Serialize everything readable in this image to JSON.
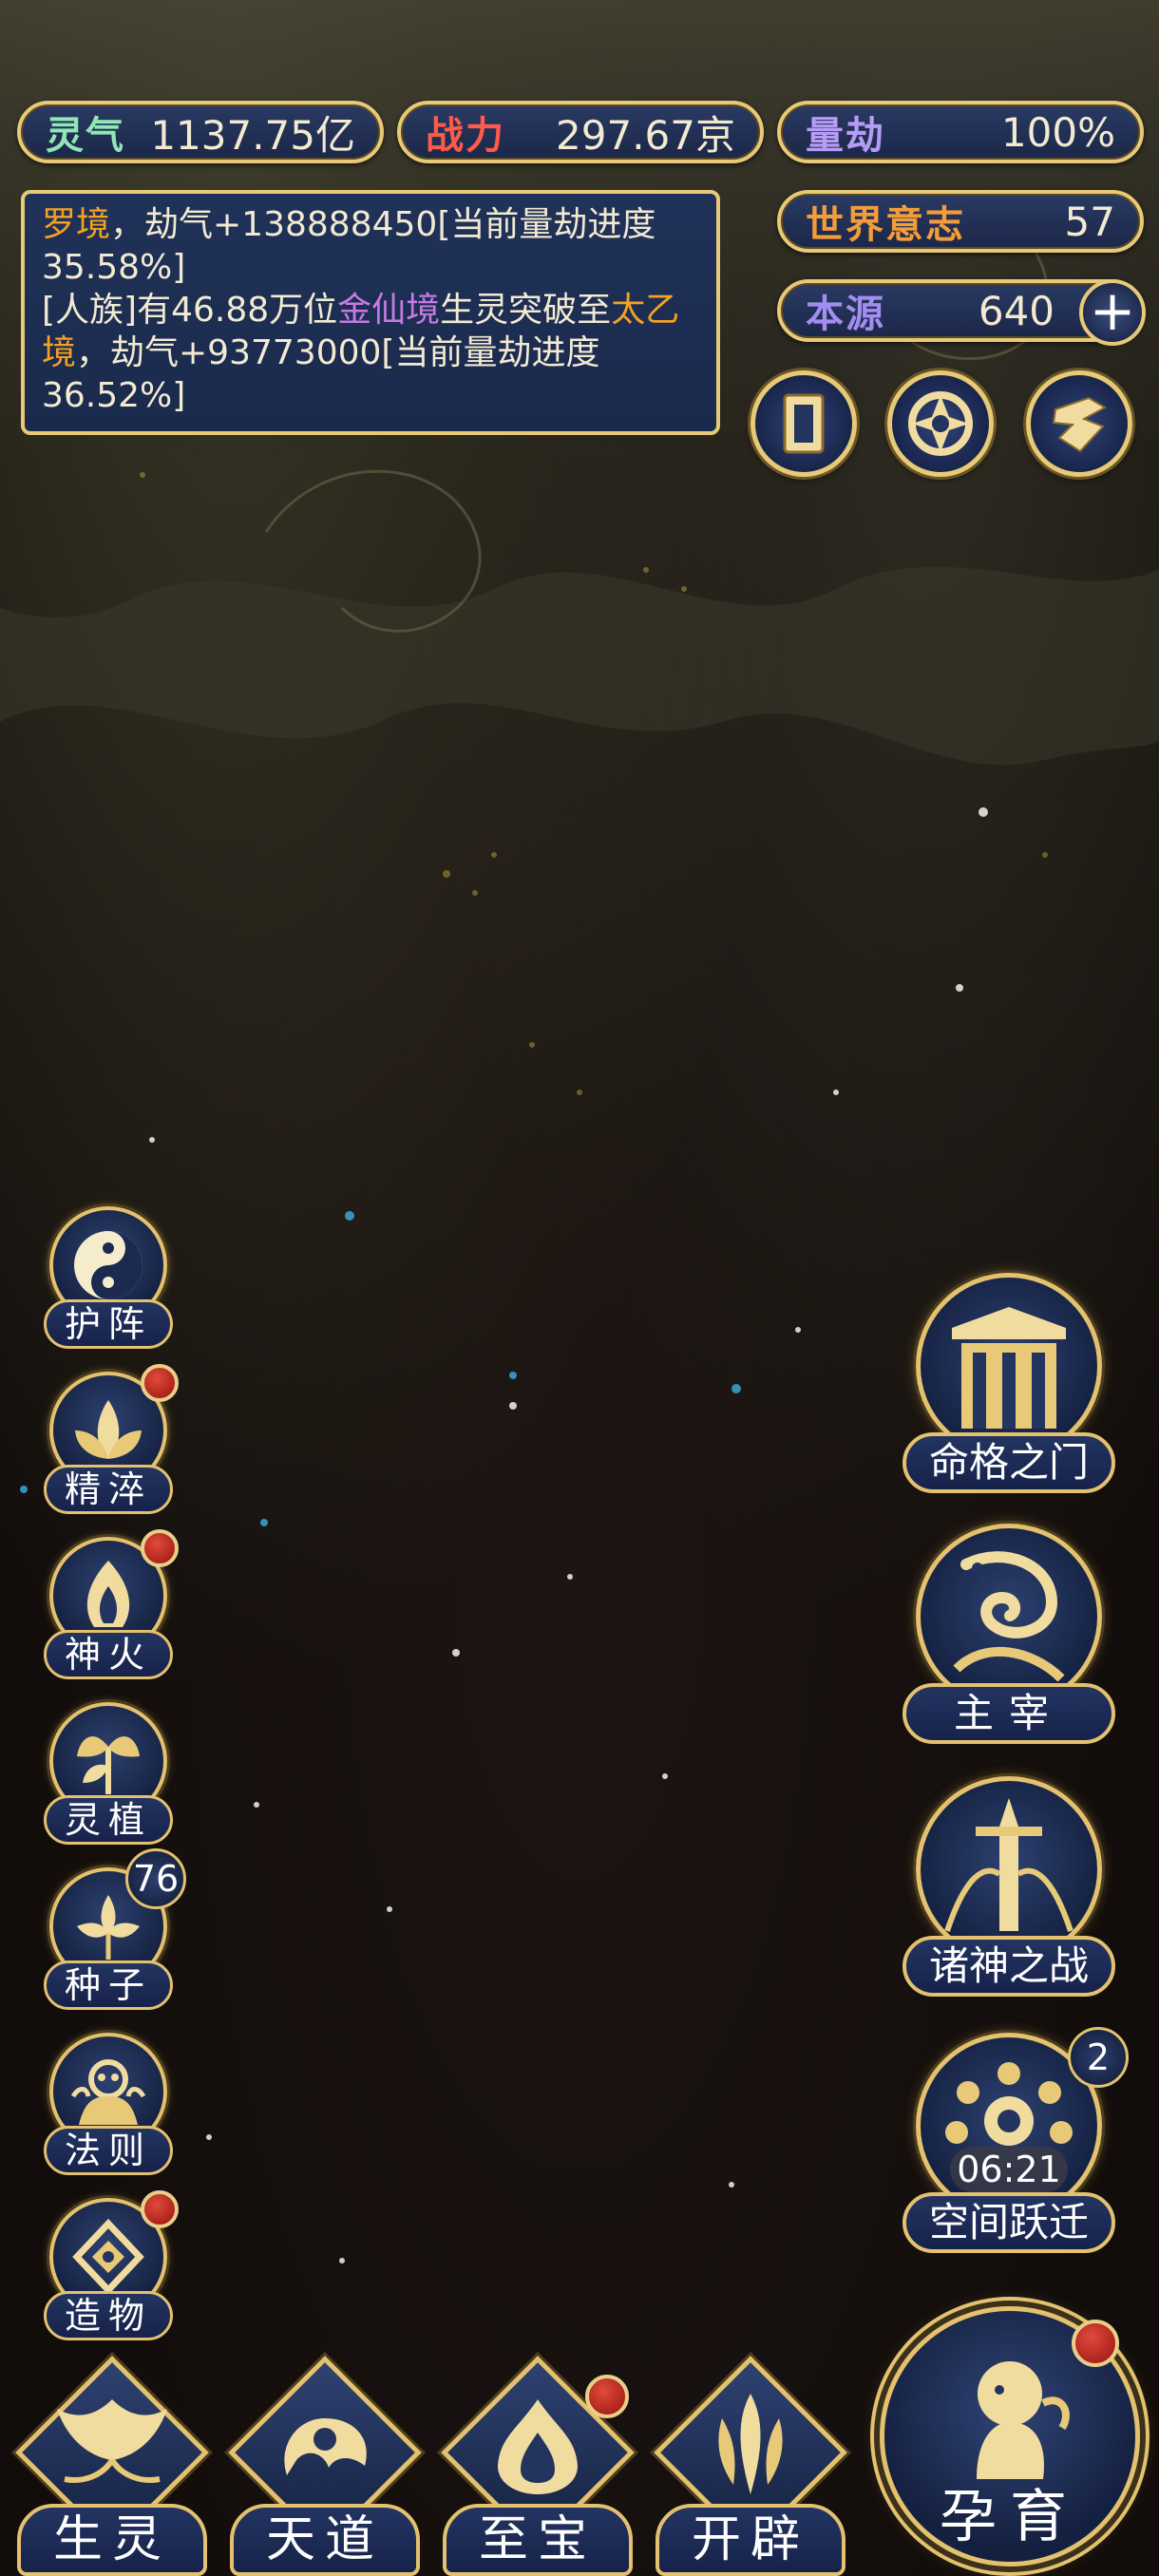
{
  "stats": {
    "lingqi": {
      "label": "灵气",
      "value": "1137.75亿",
      "color": "#8fe7b5"
    },
    "zhanli": {
      "label": "战力",
      "value": "297.67京",
      "color": "#ff5a4a"
    },
    "liangjie": {
      "label": "量劫",
      "value": "100%",
      "color": "#b59cf5"
    },
    "shijie": {
      "label": "世界意志",
      "value": "57",
      "color": "#f39c3a"
    },
    "benyuan": {
      "label": "本源",
      "value": "640",
      "color": "#a48df0",
      "plus_icon": "plus-icon"
    }
  },
  "log": {
    "line1_a": "罗境",
    "line1_b": "，劫气+138888450[当前量劫进度35.58%]",
    "line2_a": "[人族]有46.88万位",
    "line2_b": "金仙境",
    "line2_c": "生灵突破至",
    "line2_d": "太乙境",
    "line2_e": "，劫气+93773000[当前量劫进度36.52%]"
  },
  "top_buttons": [
    {
      "icon": "card-icon"
    },
    {
      "icon": "swirl-icon"
    },
    {
      "icon": "hand-icon"
    }
  ],
  "left_buttons": [
    {
      "label": "护阵",
      "icon": "taiji-icon",
      "red_dot": false
    },
    {
      "label": "精淬",
      "icon": "lotus-icon",
      "red_dot": true
    },
    {
      "label": "神火",
      "icon": "flame-icon",
      "red_dot": true
    },
    {
      "label": "灵植",
      "icon": "plant-icon",
      "red_dot": false
    },
    {
      "label": "种子",
      "icon": "seed-icon",
      "badge": "76"
    },
    {
      "label": "法则",
      "icon": "rule-icon",
      "red_dot": false
    },
    {
      "label": "造物",
      "icon": "craft-icon",
      "red_dot": true
    }
  ],
  "right_buttons": [
    {
      "label": "命格之门",
      "icon": "gate-icon"
    },
    {
      "label": "主宰",
      "icon": "dragon-icon"
    },
    {
      "label": "诸神之战",
      "icon": "sword-icon"
    },
    {
      "label": "空间跃迁",
      "icon": "portal-icon",
      "badge": "2",
      "timer": "06:21"
    }
  ],
  "bottom_nav": [
    {
      "label": "生灵",
      "icon": "phoenix-icon",
      "red_dot": false
    },
    {
      "label": "天道",
      "icon": "cloud-icon",
      "red_dot": false
    },
    {
      "label": "至宝",
      "icon": "treasure-icon",
      "red_dot": true
    },
    {
      "label": "开辟",
      "icon": "axe-icon",
      "red_dot": false
    }
  ],
  "yunyu": {
    "label": "孕育",
    "icon": "embryo-icon",
    "red_dot": true
  },
  "colors": {
    "gold": "#e7c978",
    "panel_blue": "#1b2748",
    "red_dot": "#c8281f"
  }
}
